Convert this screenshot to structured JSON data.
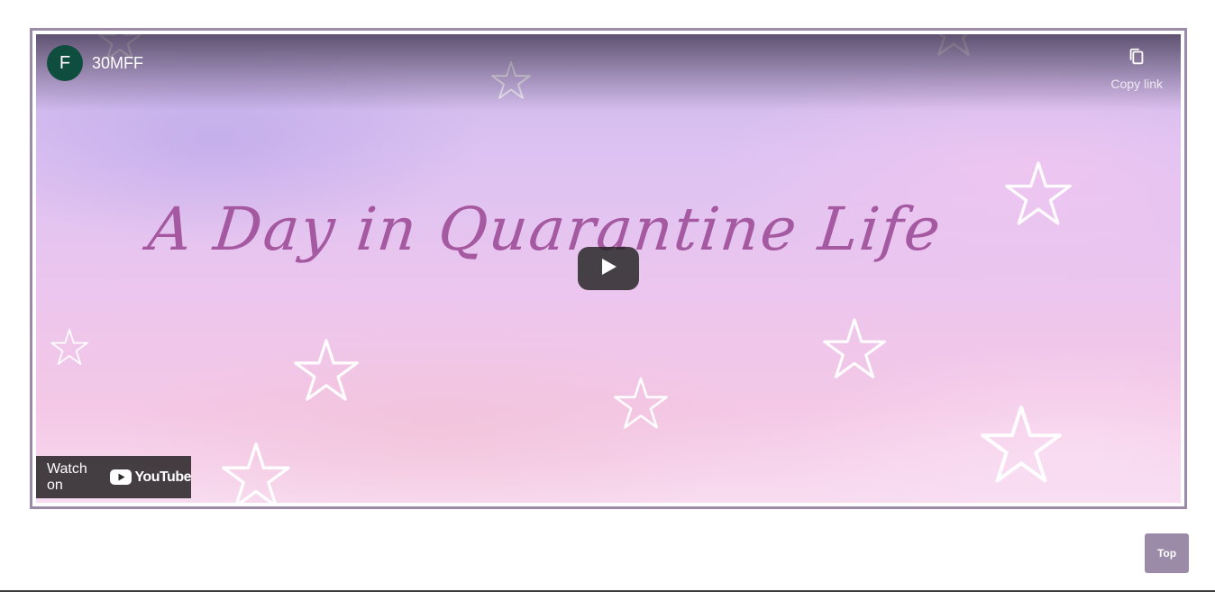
{
  "video": {
    "title_art_text": "A Day in Quarantine Life",
    "channel": {
      "avatar_letter": "F",
      "name": "30MFF"
    },
    "copy_link_label": "Copy link",
    "watch_on_label": "Watch on",
    "youtube_wordmark": "YouTube"
  },
  "page": {
    "top_button_label": "Top"
  },
  "colors": {
    "frame_border": "#9b8aa8",
    "title_art": "#a0509a",
    "avatar_bg": "#0f4d3f",
    "top_button_bg": "#9b8aa8",
    "youtube_red": "#ffffff"
  },
  "icons": [
    "copy-icon",
    "play-icon",
    "youtube-logo-icon",
    "star-icon"
  ]
}
